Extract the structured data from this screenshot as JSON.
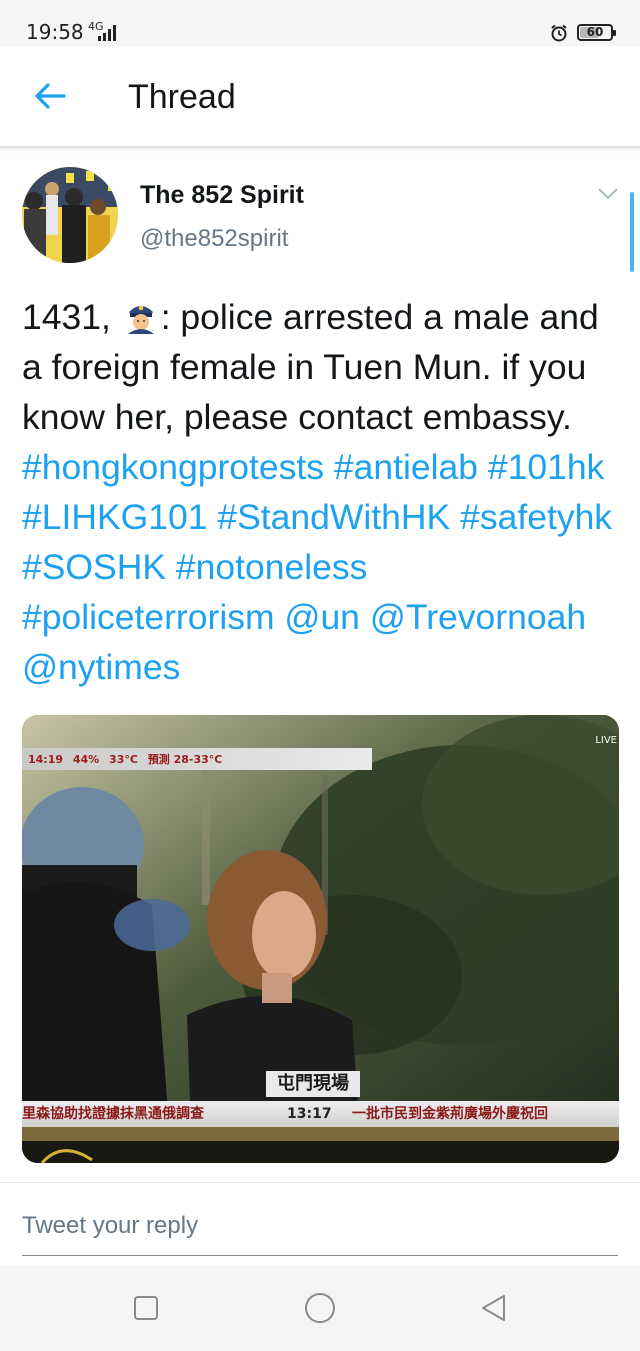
{
  "status_bar": {
    "time": "19:58",
    "network": "4G",
    "battery": "60",
    "battery_level": 0.6
  },
  "header": {
    "back_icon": "arrow-left-icon",
    "title": "Thread"
  },
  "tweet": {
    "display_name": "The 852 Spirit",
    "handle": "@the852spirit",
    "text_prefix": "1431, ",
    "emoji": "police-officer-emoji",
    "text_body": ": police arrested a male and a foreign female in Tuen Mun. if you know her, please contact embassy. ",
    "hashtags": [
      "#hongkongprotests",
      "#antielab",
      "#101hk",
      "#LIHKG101",
      "#StandWithHK",
      "#safetyhk",
      "#SOSHK",
      "#notoneless",
      "#policeterrorism"
    ],
    "mentions": [
      "@un",
      "@Trevornoah",
      "@nytimes"
    ],
    "media": {
      "top_bar": [
        "14:19",
        "44%",
        "33°C",
        "預測 28-33°C"
      ],
      "live": "LIVE",
      "location": "屯門現場",
      "ticker_left": "里森協助找證據抹黑通俄調查",
      "ticker_time": "13:17",
      "ticker_right": "一批市民到金紫荊廣場外慶祝回"
    }
  },
  "reply": {
    "placeholder": "Tweet your reply"
  },
  "colors": {
    "link": "#1da1f2",
    "text": "#14171a",
    "secondary": "#657786"
  }
}
